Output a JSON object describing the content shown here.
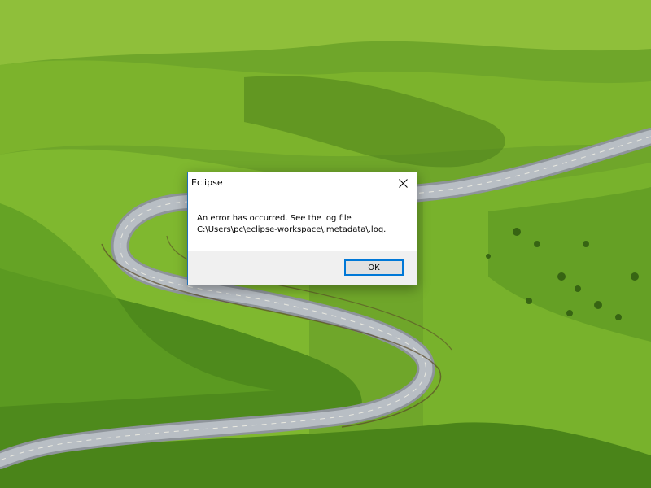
{
  "dialog": {
    "title": "Eclipse",
    "message_line1": "An error has occurred. See the log file",
    "message_line2": "C:\\Users\\pc\\eclipse-workspace\\.metadata\\.log.",
    "ok_label": "OK",
    "close_icon": "close-icon"
  },
  "wallpaper": {
    "description_colors": {
      "grass_light": "#8cc63f",
      "grass_dark": "#3e7a12",
      "road": "#9aa0a6"
    }
  }
}
